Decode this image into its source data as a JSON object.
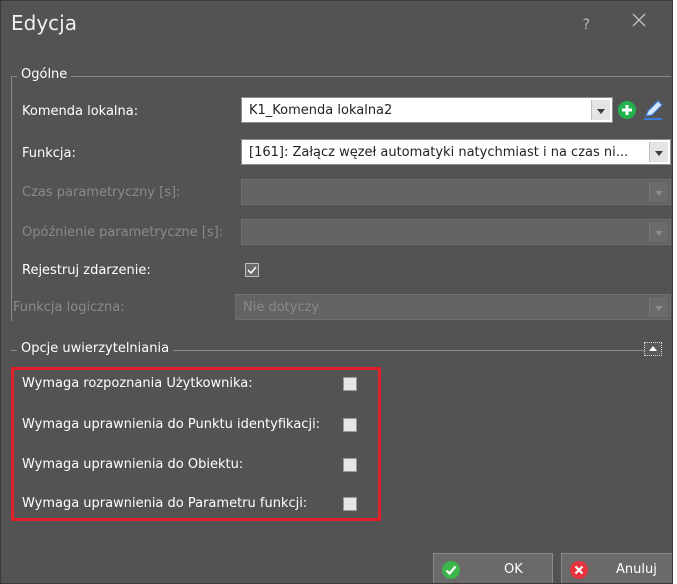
{
  "dialog": {
    "title": "Edycja",
    "help_label": "?",
    "close_icon": "close-icon"
  },
  "general": {
    "section_title": "Ogólne",
    "local_command": {
      "label": "Komenda lokalna:",
      "value": "K1_Komenda lokalna2",
      "add_icon": "plus-circle-icon",
      "edit_icon": "pencil-icon"
    },
    "function": {
      "label": "Funkcja:",
      "value": "[161]: Załącz węzeł automatyki natychmiast i na czas ni..."
    },
    "param_time": {
      "label": "Czas parametryczny [s]:",
      "value": ""
    },
    "param_delay": {
      "label": "Opóźnienie parametryczne [s]:",
      "value": ""
    },
    "log_event": {
      "label": "Rejestruj zdarzenie:",
      "checked": true
    },
    "logic_function": {
      "label": "Funkcja logiczna:",
      "value": "Nie dotyczy"
    }
  },
  "auth": {
    "section_title": "Opcje uwierzytelniania",
    "options": [
      {
        "label": "Wymaga rozpoznania Użytkownika:",
        "checked": false
      },
      {
        "label": "Wymaga uprawnienia do Punktu identyfikacji:",
        "checked": false
      },
      {
        "label": "Wymaga uprawnienia do Obiektu:",
        "checked": false
      },
      {
        "label": "Wymaga uprawnienia do Parametru funkcji:",
        "checked": false
      }
    ]
  },
  "footer": {
    "ok_label": "OK",
    "cancel_label": "Anuluj",
    "ok_icon": "check-circle-icon",
    "cancel_icon": "x-circle-icon"
  },
  "colors": {
    "dialog_bg": "#535353",
    "ok_green": "#3cb54a",
    "cancel_red": "#e5333d",
    "highlight_red": "#e0202a",
    "add_green": "#22b14c"
  }
}
